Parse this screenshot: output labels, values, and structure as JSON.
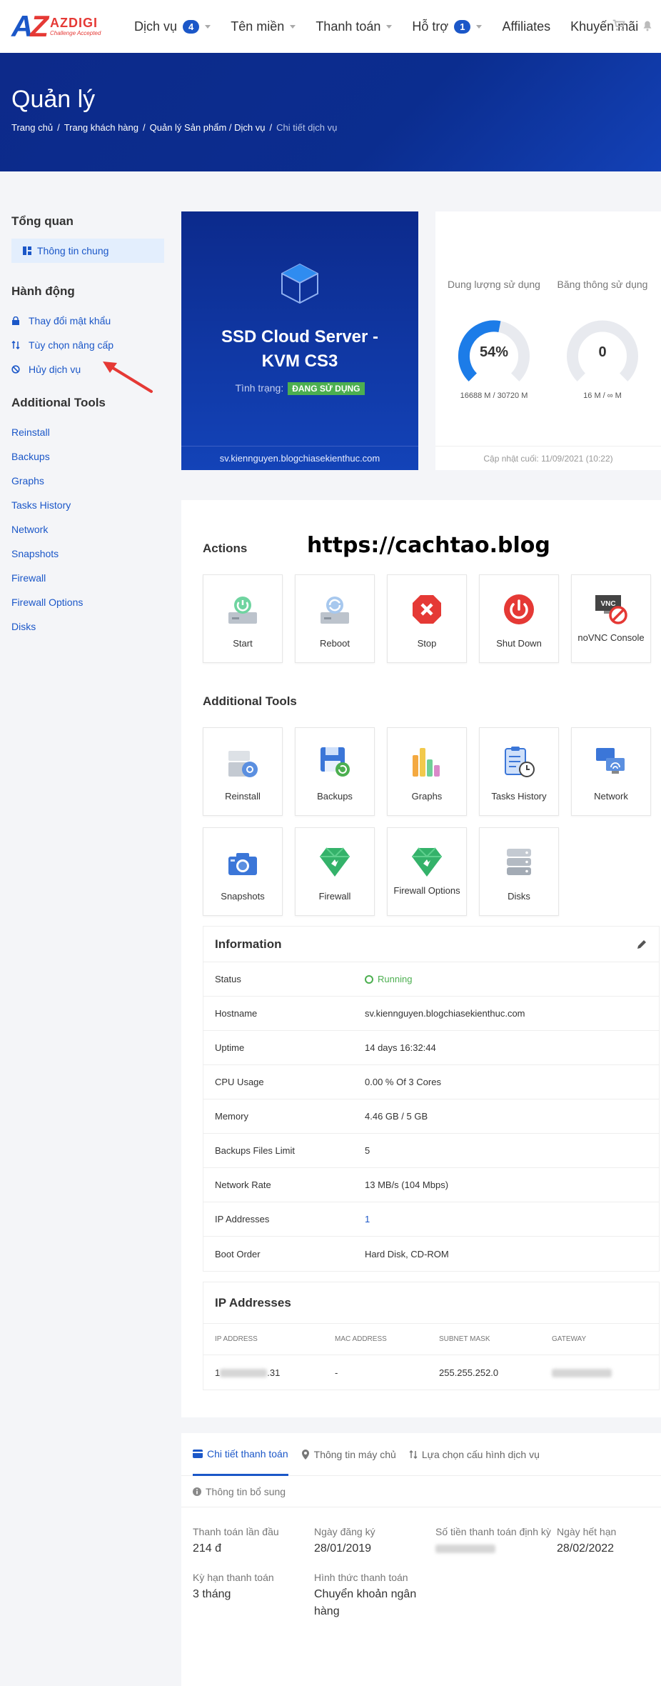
{
  "brand": {
    "letters": "AZ",
    "name": "AZDIGI",
    "tagline": "Challenge Accepted"
  },
  "nav": {
    "items": [
      {
        "label": "Dịch vụ",
        "badge": "4",
        "caret": true
      },
      {
        "label": "Tên miền",
        "caret": true
      },
      {
        "label": "Thanh toán",
        "caret": true
      },
      {
        "label": "Hỗ trợ",
        "badge": "1",
        "caret": true
      },
      {
        "label": "Affiliates"
      },
      {
        "label": "Khuyến mãi"
      }
    ]
  },
  "hero": {
    "title": "Quản lý",
    "breadcrumb": [
      "Trang chủ",
      "Trang khách hàng",
      "Quản lý Sản phẩm / Dịch vụ",
      "Chi tiết dịch vụ"
    ],
    "separator": "/"
  },
  "sidebar": {
    "overview_heading": "Tổng quan",
    "overview_active": "Thông tin chung",
    "actions_heading": "Hành động",
    "actions": [
      "Thay đổi mật khẩu",
      "Tùy chọn nâng cấp",
      "Hủy dịch vụ"
    ],
    "tools_heading": "Additional Tools",
    "tools": [
      "Reinstall",
      "Backups",
      "Graphs",
      "Tasks History",
      "Network",
      "Snapshots",
      "Firewall",
      "Firewall Options",
      "Disks"
    ]
  },
  "product": {
    "name": "SSD Cloud Server - KVM CS3",
    "status_label": "Tình trạng:",
    "status": "ĐANG SỬ DỤNG",
    "hostname": "sv.kiennguyen.blogchiasekienthuc.com"
  },
  "usage": {
    "disk": {
      "title": "Dung lượng sử dụng",
      "value": "54%",
      "percent": 54,
      "sub": "16688 M / 30720 M"
    },
    "bandwidth": {
      "title": "Băng thông sử dụng",
      "value": "0",
      "percent": 0,
      "sub": "16 M / ∞ M"
    },
    "updated": "Cập nhật cuối: 11/09/2021 (10:22)"
  },
  "watermark": "https://cachtao.blog",
  "actions": {
    "heading": "Actions",
    "items": [
      "Start",
      "Reboot",
      "Stop",
      "Shut Down",
      "noVNC Console"
    ],
    "vnc_badge": "VNC"
  },
  "tools": {
    "heading": "Additional Tools",
    "items": [
      "Reinstall",
      "Backups",
      "Graphs",
      "Tasks History",
      "Network",
      "Snapshots",
      "Firewall",
      "Firewall Options",
      "Disks"
    ]
  },
  "information": {
    "heading": "Information",
    "rows": [
      {
        "k": "Status",
        "v": "Running"
      },
      {
        "k": "Hostname",
        "v": "sv.kiennguyen.blogchiasekienthuc.com"
      },
      {
        "k": "Uptime",
        "v": "14 days 16:32:44"
      },
      {
        "k": "CPU Usage",
        "v": "0.00 % Of 3 Cores"
      },
      {
        "k": "Memory",
        "v": "4.46 GB / 5 GB"
      },
      {
        "k": "Backups Files Limit",
        "v": "5"
      },
      {
        "k": "Network Rate",
        "v": "13 MB/s (104 Mbps)"
      },
      {
        "k": "IP Addresses",
        "v": "1"
      },
      {
        "k": "Boot Order",
        "v": "Hard Disk, CD-ROM"
      }
    ]
  },
  "ip_table": {
    "heading": "IP Addresses",
    "columns": [
      "IP ADDRESS",
      "MAC ADDRESS",
      "SUBNET MASK",
      "GATEWAY"
    ],
    "row": {
      "ip_start": "1",
      "ip_end": ".31",
      "mac": "-",
      "mask": "255.255.252.0"
    }
  },
  "billing": {
    "tabs": [
      "Chi tiết thanh toán",
      "Thông tin máy chủ",
      "Lựa chọn cấu hình dịch vụ"
    ],
    "subtab": "Thông tin bổ sung",
    "fields": [
      {
        "k": "Thanh toán lần đầu",
        "v": "214 đ"
      },
      {
        "k": "Ngày đăng ký",
        "v": "28/01/2019"
      },
      {
        "k": "Số tiền thanh toán định kỳ",
        "v": ""
      },
      {
        "k": "Ngày hết hạn",
        "v": "28/02/2022"
      },
      {
        "k": "Kỳ hạn thanh toán",
        "v": "3 tháng"
      },
      {
        "k": "Hình thức thanh toán",
        "v": "Chuyển khoản ngân hàng"
      }
    ]
  }
}
